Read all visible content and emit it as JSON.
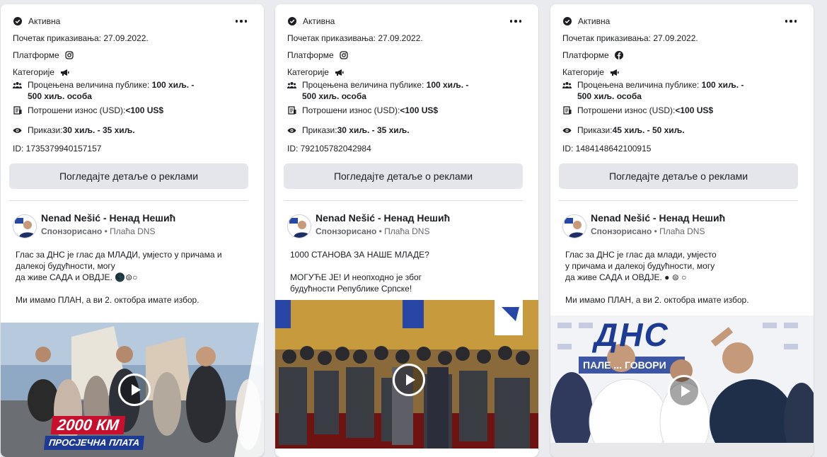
{
  "cards": [
    {
      "status": "Активна",
      "start": "Почетак приказивања: 27.09.2022.",
      "platforms_label": "Платформе",
      "platform_icon": "instagram-icon",
      "categories_label": "Категорије",
      "audience_label": "Процењена величина публике: ",
      "audience_value_1": "100 хиљ. -",
      "audience_value_2": "500 хиљ. особа",
      "spent_label": "Потрошени износ (USD): ",
      "spent_value": "<100 US$",
      "impressions_label": "Прикази: ",
      "impressions_value": "30 хиљ. - 35 хиљ.",
      "id": "ID: 1735379940157157",
      "cta": "Погледајте детаље о реклами",
      "page_name": "Nenad Nešić - Ненад Нешић",
      "sponsored": "Спонзорисано",
      "paid_by": " • Плаћа DNS",
      "text": "Глас за ДНС је глас да МЛАДИ, умјесто у причама и\nдалекој будућности, могу\nда живе САДА и ОВДЈЕ. 🌑⊜○\n\nМи имамо ПЛАН, а ви 2. октобра имате избор.",
      "overlay_line1": "2000 КМ",
      "overlay_line2": "ПРОСЈЕЧНА ПЛАТА"
    },
    {
      "status": "Активна",
      "start": "Почетак приказивања: 27.09.2022.",
      "platforms_label": "Платформе",
      "platform_icon": "instagram-icon",
      "categories_label": "Категорије",
      "audience_label": "Процењена величина публике: ",
      "audience_value_1": "100 хиљ. -",
      "audience_value_2": "500 хиљ. особа",
      "spent_label": "Потрошени износ (USD): ",
      "spent_value": "<100 US$",
      "impressions_label": "Прикази: ",
      "impressions_value": "30 хиљ. - 35 хиљ.",
      "id": "ID: 792105782042984",
      "cta": "Погледајте детаље о реклами",
      "page_name": "Nenad Nešić - Ненад Нешић",
      "sponsored": "Спонзорисано",
      "paid_by": " • Плаћа DNS",
      "text": "1000 СТАНОВА ЗА НАШЕ МЛАДЕ?\n\nМОГУЋЕ ЈЕ! И неопходно је због\nбудућности Републике Српске!"
    },
    {
      "status": "Активна",
      "start": "Почетак приказивања: 27.09.2022.",
      "platforms_label": "Платформе",
      "platform_icon": "facebook-icon",
      "categories_label": "Категорије",
      "audience_label": "Процењена величина публике: ",
      "audience_value_1": "100 хиљ. -",
      "audience_value_2": "500 хиљ. особа",
      "spent_label": "Потрошени износ (USD): ",
      "spent_value": "<100 US$",
      "impressions_label": "Прикази: ",
      "impressions_value": "45 хиљ. - 50 хиљ.",
      "id": "ID: 1484148642100915",
      "cta": "Погледајте детаље о реклами",
      "page_name": "Nenad Nešić - Ненад Нешић",
      "sponsored": "Спонзорисано",
      "paid_by": " • Плаћа DNS",
      "text": "Глас за ДНС је глас да млади, умјесто\nу причама и далекој будућности, могу\nда живе САДА и ОВДЈЕ. ● ⊜ ○\n\nМи имамо ПЛАН, а ви 2. октобра имате избор.",
      "banner_text": "ДНС",
      "banner_sub": "ПАЛЕ ... ГОВОРИ"
    }
  ]
}
